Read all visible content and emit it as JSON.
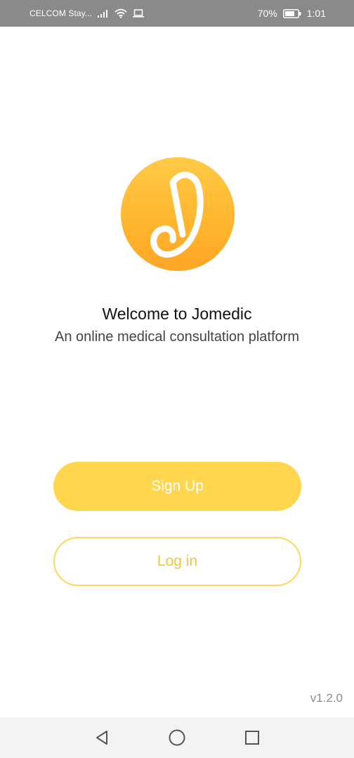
{
  "status_bar": {
    "carrier": "CELCOM Stay...",
    "battery_percent": "70%",
    "time": "1:01",
    "icons": [
      "signal-icon",
      "wifi-icon",
      "laptop-icon",
      "battery-icon"
    ]
  },
  "logo": {
    "icon": "jomedic-logo-icon",
    "colors": [
      "#ffca46",
      "#ffa526"
    ]
  },
  "welcome": {
    "title": "Welcome to Jomedic",
    "subtitle": "An online medical consultation platform"
  },
  "buttons": {
    "signup_label": "Sign Up",
    "login_label": "Log in"
  },
  "version": "v1.2.0",
  "nav_bar": {
    "icons": [
      "back-icon",
      "home-icon",
      "recents-icon"
    ]
  },
  "colors": {
    "accent": "#ffd64d",
    "login_text": "#f2c63a",
    "status_bar": "#8a8a8a"
  }
}
